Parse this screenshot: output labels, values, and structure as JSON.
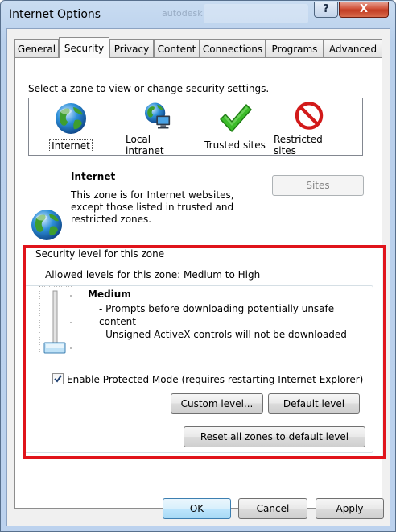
{
  "window": {
    "title": "Internet Options",
    "help_label": "?",
    "close_label": "X",
    "ghost_text": "autodesk"
  },
  "tabs": [
    {
      "label": "General"
    },
    {
      "label": "Security"
    },
    {
      "label": "Privacy"
    },
    {
      "label": "Content"
    },
    {
      "label": "Connections"
    },
    {
      "label": "Programs"
    },
    {
      "label": "Advanced"
    }
  ],
  "active_tab": "Security",
  "zone_prompt": "Select a zone to view or change security settings.",
  "zones": [
    {
      "label": "Internet",
      "icon": "globe-icon",
      "selected": true
    },
    {
      "label": "Local intranet",
      "icon": "globe-computer-icon",
      "selected": false
    },
    {
      "label": "Trusted sites",
      "icon": "green-check-icon",
      "selected": false
    },
    {
      "label": "Restricted sites",
      "icon": "red-no-entry-icon",
      "selected": false
    }
  ],
  "zone_info": {
    "title": "Internet",
    "line1": "This zone is for Internet websites,",
    "line2": "except those listed in trusted and",
    "line3": "restricted zones.",
    "sites_button": "Sites",
    "sites_button_enabled": false
  },
  "security_level": {
    "group_label": "Security level for this zone",
    "allowed_levels": "Allowed levels for this zone: Medium to High",
    "level_name": "Medium",
    "desc1": "- Prompts before downloading potentially unsafe",
    "desc2": "content",
    "desc3": "- Unsigned ActiveX controls will not be downloaded",
    "slider_position": 0,
    "slider_steps": 3
  },
  "protected_mode": {
    "label": "Enable Protected Mode (requires restarting Internet Explorer)",
    "checked": true
  },
  "buttons": {
    "custom_level": "Custom level...",
    "default_level": "Default level",
    "reset_all": "Reset all zones to default level",
    "ok": "OK",
    "cancel": "Cancel",
    "apply": "Apply"
  },
  "highlight": {
    "color": "#e0141b"
  }
}
